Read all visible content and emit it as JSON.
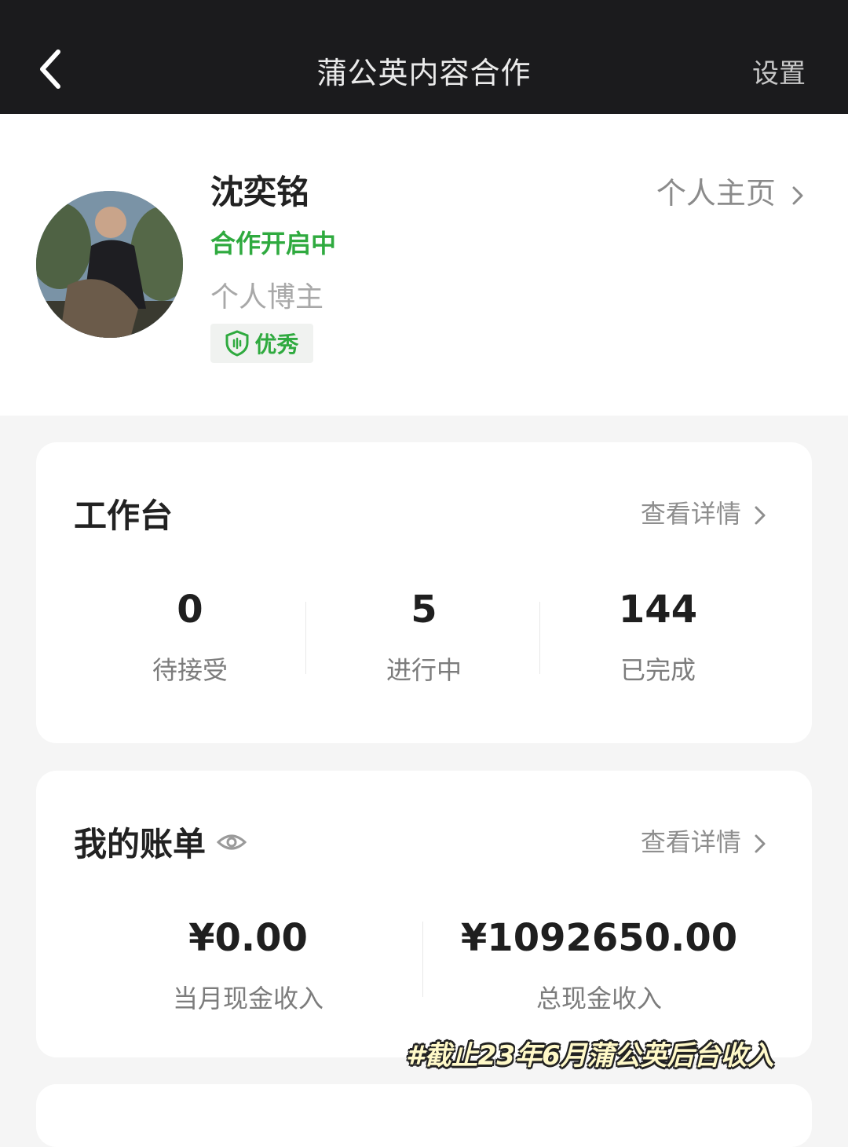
{
  "header": {
    "title": "蒲公英内容合作",
    "settings_label": "设置"
  },
  "profile": {
    "name": "沈奕铭",
    "homepage_label": "个人主页",
    "status": "合作开启中",
    "role": "个人博主",
    "badge_label": "优秀"
  },
  "workbench": {
    "title": "工作台",
    "link_label": "查看详情",
    "stats": [
      {
        "value": "0",
        "label": "待接受"
      },
      {
        "value": "5",
        "label": "进行中"
      },
      {
        "value": "144",
        "label": "已完成"
      }
    ]
  },
  "bill": {
    "title": "我的账单",
    "link_label": "查看详情",
    "items": [
      {
        "value": "¥0.00",
        "label": "当月现金收入"
      },
      {
        "value": "¥1092650.00",
        "label": "总现金收入"
      }
    ]
  },
  "caption": "#截止23年6月蒲公英后台收入",
  "colors": {
    "topbar": "#1b1b1d",
    "accent_green": "#2faa3f"
  }
}
